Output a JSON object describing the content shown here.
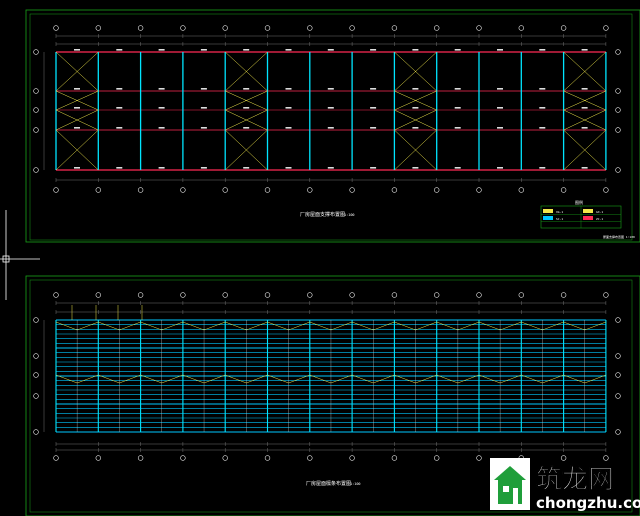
{
  "colors": {
    "frame": "#18a318",
    "grid_bubble": "#e6e6e6",
    "column": "#00e5ff",
    "beam": "#ff2a55",
    "brace": "#f2e84a",
    "purlin": "#00c8ff",
    "dim": "#8a8a8a",
    "text": "#ffffff",
    "crosshair": "#ffffff"
  },
  "top_plan": {
    "title": "厂房屋面支撑布置图",
    "scale": "1:100",
    "legend_title": "图例",
    "legend_rows": [
      "XG-1",
      "SC-1",
      "GX-1",
      "ZC-1"
    ],
    "stamp": "屋面支撑布置图 1:100"
  },
  "bottom_plan": {
    "title": "厂房屋面檩条布置图",
    "scale": "1:100"
  },
  "watermark": {
    "brand_cn": "筑龙网",
    "domain": "chongzhu.com",
    "icon": "house-icon"
  }
}
